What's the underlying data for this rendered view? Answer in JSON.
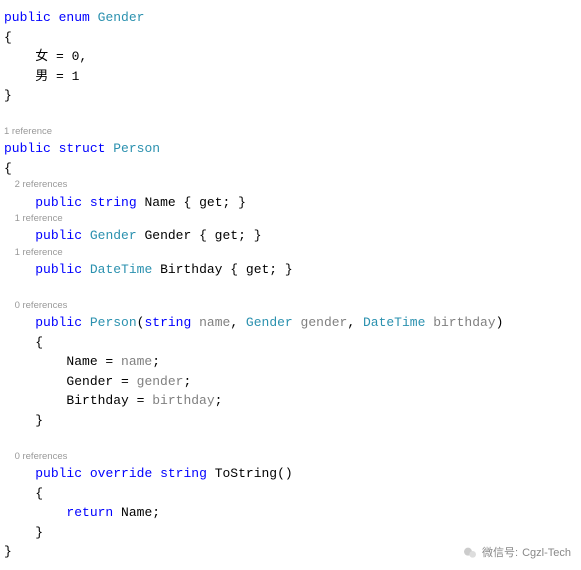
{
  "enum": {
    "access": "public",
    "kw": "enum",
    "name": "Gender",
    "open": "{",
    "close": "}",
    "m1": "女 = 0,",
    "m2": "男 = 1"
  },
  "struct": {
    "ref": "1 reference",
    "access": "public",
    "kw": "struct",
    "name": "Person",
    "open": "{",
    "close": "}"
  },
  "props": {
    "name": {
      "ref": "2 references",
      "access": "public",
      "type": "string",
      "id": "Name",
      "acc": " { get; }"
    },
    "gender": {
      "ref": "1 reference",
      "access": "public",
      "type": "Gender",
      "id": "Gender",
      "acc": " { get; }"
    },
    "birthday": {
      "ref": "1 reference",
      "access": "public",
      "type": "DateTime",
      "id": "Birthday",
      "acc": " { get; }"
    }
  },
  "ctor": {
    "ref": "0 references",
    "access": "public",
    "name": "Person",
    "p1t": "string",
    "p1n": "name",
    "p2t": "Gender",
    "p2n": "gender",
    "p3t": "DateTime",
    "p3n": "birthday",
    "open": "{",
    "b1a": "Name = ",
    "b1b": "name",
    "b1c": ";",
    "b2a": "Gender = ",
    "b2b": "gender",
    "b2c": ";",
    "b3a": "Birthday = ",
    "b3b": "birthday",
    "b3c": ";",
    "close": "}"
  },
  "tostr": {
    "ref": "0 references",
    "access": "public",
    "override": "override",
    "rettype": "string",
    "name": "ToString",
    "parens": "()",
    "open": "{",
    "ret_kw": "return",
    "ret_val": " Name;",
    "close": "}"
  },
  "watermark": {
    "label": "微信号:",
    "value": "Cgzl-Tech"
  }
}
